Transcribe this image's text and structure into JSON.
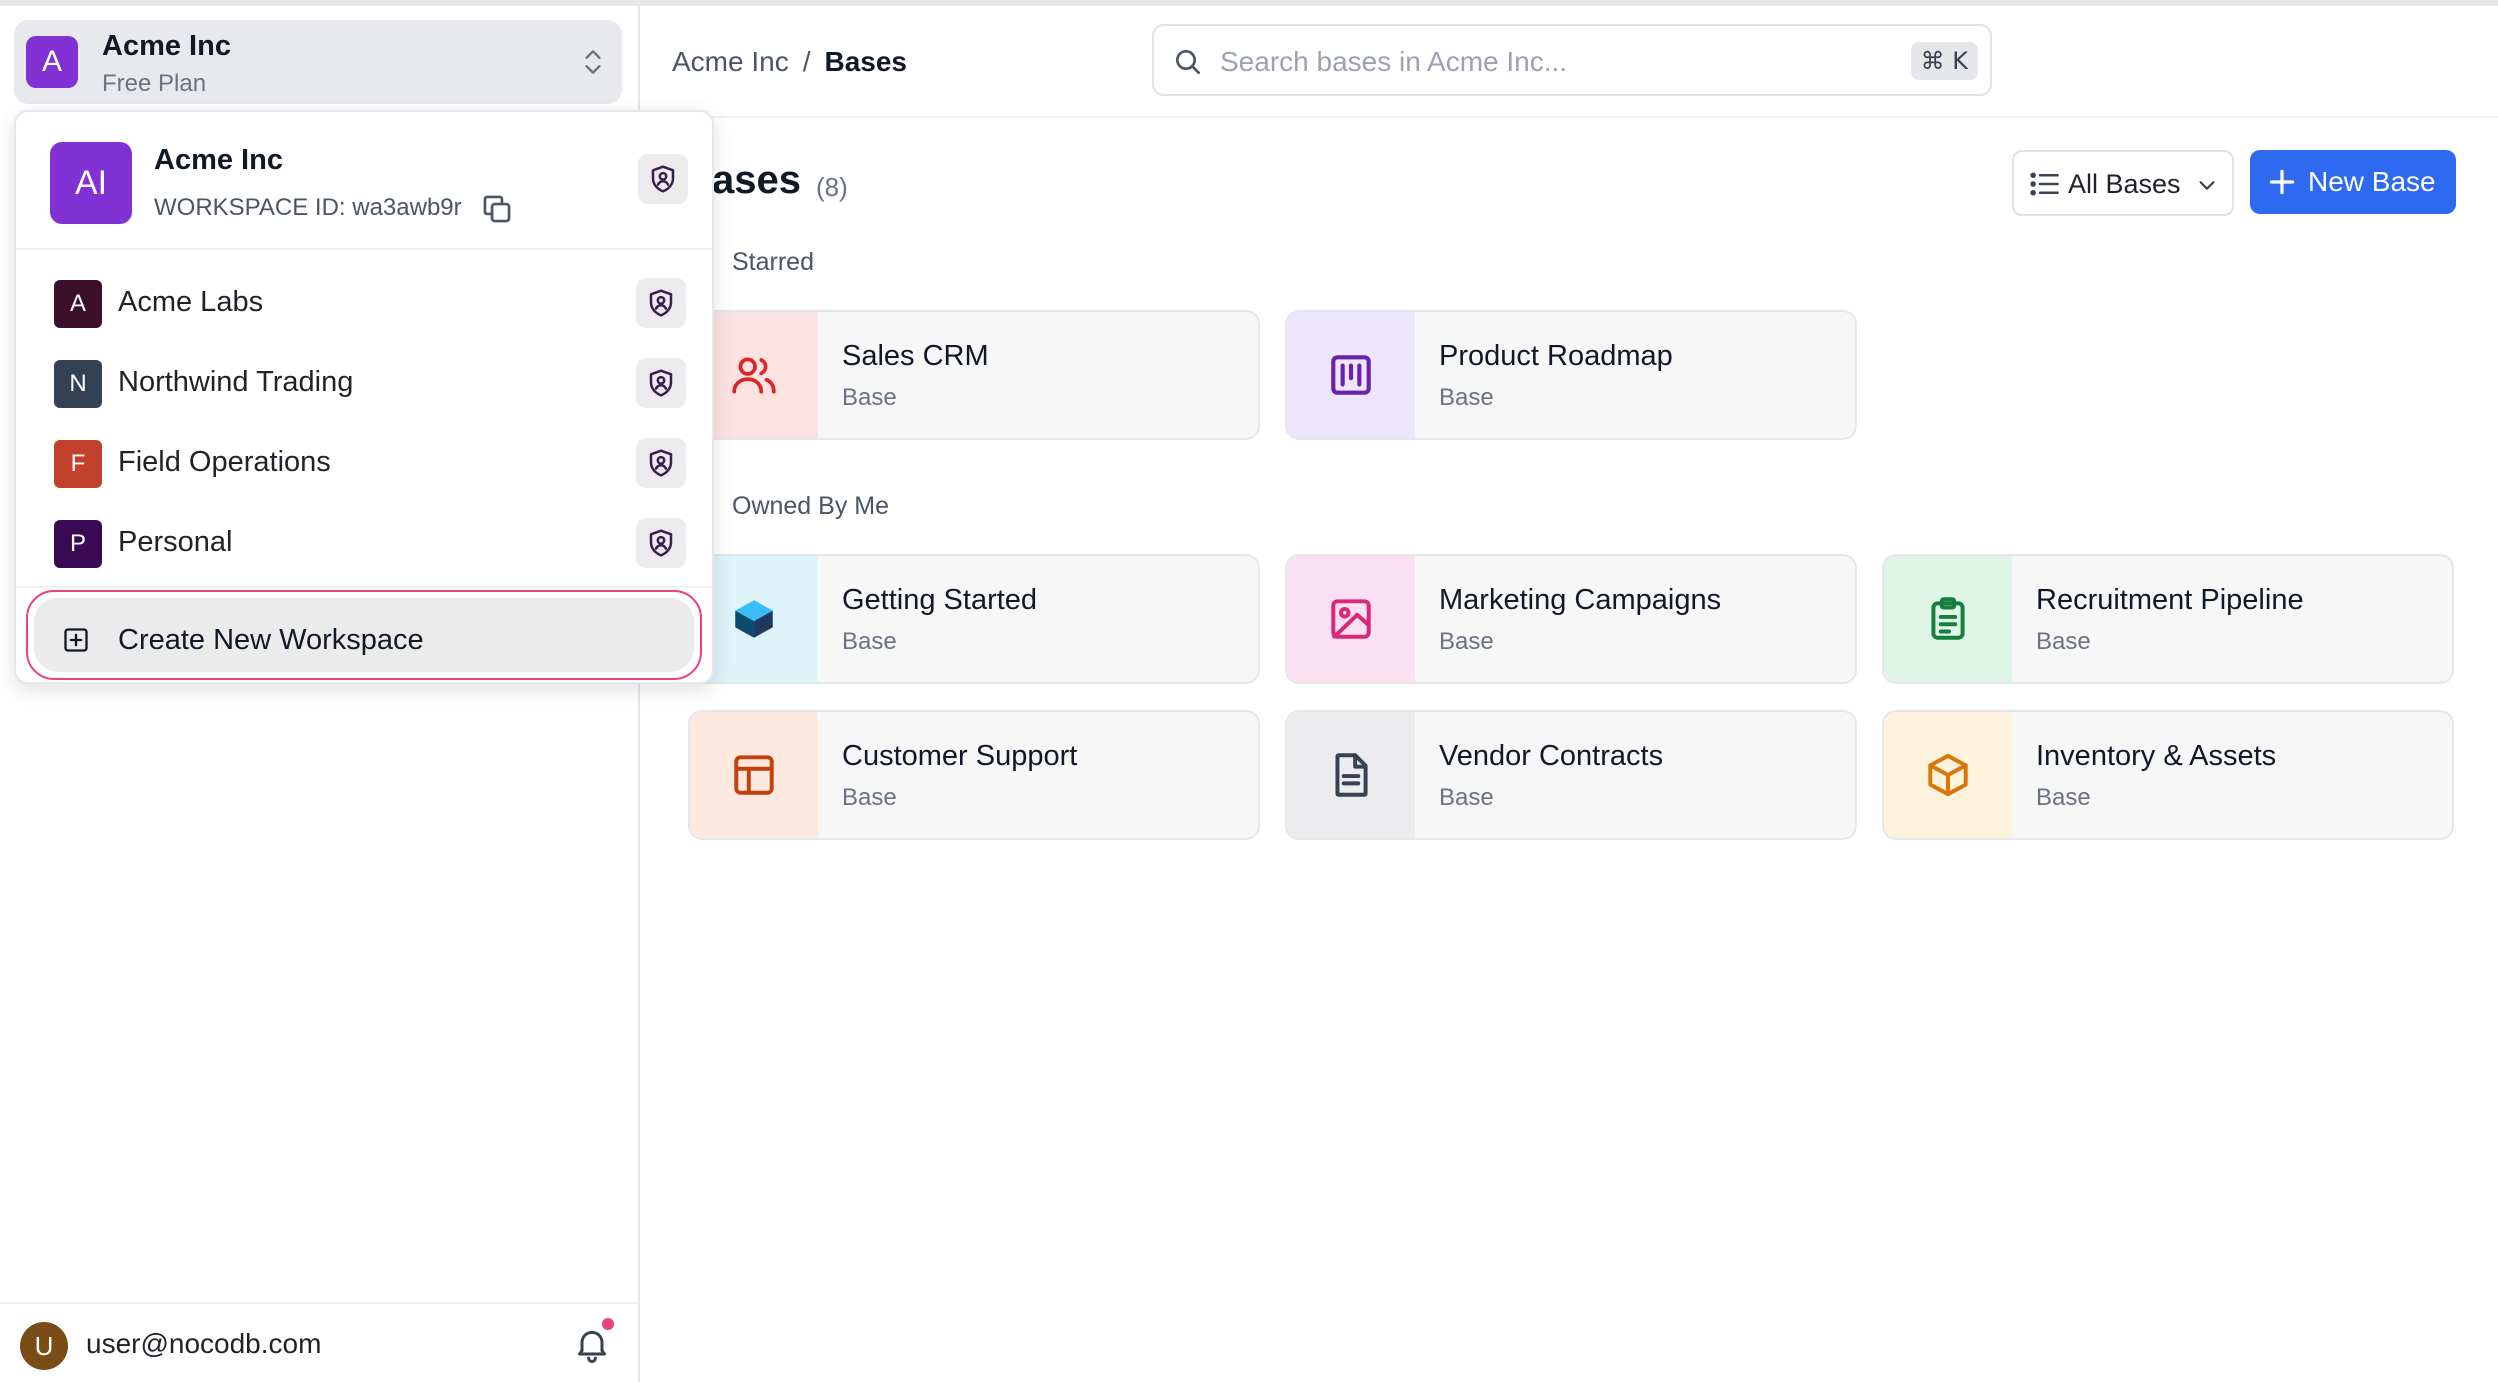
{
  "workspace": {
    "name": "Acme Inc",
    "plan": "Free Plan",
    "initial": "A"
  },
  "header": {
    "breadcrumb_root": "Acme Inc",
    "breadcrumb_sep": "/",
    "breadcrumb_current": "Bases",
    "search_placeholder": "Search bases in Acme Inc...",
    "search_shortcut": "⌘ K"
  },
  "main": {
    "title": "Bases",
    "title_visible": "ases",
    "count": "(8)",
    "filter_label": "All Bases",
    "new_label": "New Base",
    "starred_label": "Starred",
    "owned_label": "Owned By Me"
  },
  "starred": [
    {
      "name": "Sales CRM",
      "type": "Base",
      "icon": "users-icon",
      "bg": "#fde2e2",
      "color": "#dc2626"
    },
    {
      "name": "Product Roadmap",
      "type": "Base",
      "icon": "kanban-icon",
      "bg": "#ede5fb",
      "color": "#6b21a8"
    }
  ],
  "owned": [
    {
      "name": "Getting Started",
      "type": "Base",
      "icon": "cube-layers-icon",
      "bg": "#dff3fb",
      "color": "#0ea5e9"
    },
    {
      "name": "Marketing Campaigns",
      "type": "Base",
      "icon": "image-icon",
      "bg": "#fbe0f1",
      "color": "#db2777"
    },
    {
      "name": "Recruitment Pipeline",
      "type": "Base",
      "icon": "clipboard-icon",
      "bg": "#dff5e6",
      "color": "#15803d"
    },
    {
      "name": "Customer Support",
      "type": "Base",
      "icon": "layout-icon",
      "bg": "#fde9df",
      "color": "#c2410c"
    },
    {
      "name": "Vendor Contracts",
      "type": "Base",
      "icon": "document-icon",
      "bg": "#ececef",
      "color": "#374151"
    },
    {
      "name": "Inventory & Assets",
      "type": "Base",
      "icon": "box-icon",
      "bg": "#fdf2dc",
      "color": "#d97706"
    }
  ],
  "dropdown": {
    "current_initials": "AI",
    "current_name": "Acme Inc",
    "workspace_id": "WORKSPACE ID: wa3awb9r",
    "workspaces": [
      {
        "initial": "A",
        "name": "Acme Labs",
        "color": "#3b0f2a"
      },
      {
        "initial": "N",
        "name": "Northwind Trading",
        "color": "#334155"
      },
      {
        "initial": "F",
        "name": "Field Operations",
        "color": "#c2412d"
      },
      {
        "initial": "P",
        "name": "Personal",
        "color": "#3b0a54"
      }
    ],
    "create_label": "Create New Workspace"
  },
  "user": {
    "initial": "U",
    "email": "user@nocodb.com"
  },
  "colors": {
    "accent": "#2e6af0",
    "workspace_avatar": "#8131d4",
    "focus_ring": "#ec3f84",
    "notification_dot": "#f0427a"
  }
}
